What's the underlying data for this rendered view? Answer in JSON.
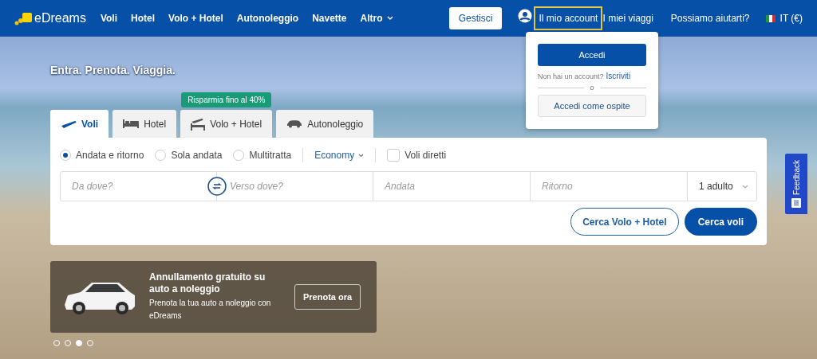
{
  "header": {
    "logo": "eDreams",
    "nav": [
      {
        "label": "Voli",
        "dropdown": false
      },
      {
        "label": "Hotel",
        "dropdown": false
      },
      {
        "label": "Volo + Hotel",
        "dropdown": false
      },
      {
        "label": "Autonoleggio",
        "dropdown": false
      },
      {
        "label": "Navette",
        "dropdown": false
      },
      {
        "label": "Altro",
        "dropdown": true
      }
    ],
    "manage_button": "Gestisci",
    "account_link": {
      "label": "Il mio account",
      "highlighted": true
    },
    "trips_link": "I miei viaggi",
    "help_link": "Possiamo aiutarti?",
    "locale": "IT (€)"
  },
  "account_menu": {
    "login_button": "Accedi",
    "signup_prompt": "Non hai un account?",
    "signup_link": "Iscriviti",
    "separator": "o",
    "guest_button": "Accedi come ospite"
  },
  "hero": {
    "tagline": "Entra. Prenota. Viaggia."
  },
  "tabs": [
    {
      "label": "Voli",
      "kind": "plane",
      "selected": true
    },
    {
      "label": "Hotel",
      "kind": "bed",
      "selected": false
    },
    {
      "label": "Volo + Hotel",
      "kind": "plane-bed",
      "selected": false,
      "badge": "Risparmia fino al 40%"
    },
    {
      "label": "Autonoleggio",
      "kind": "car",
      "selected": false
    }
  ],
  "trip_types": [
    {
      "label": "Andata e ritorno",
      "selected": true
    },
    {
      "label": "Sola andata",
      "selected": false
    },
    {
      "label": "Multitratta",
      "selected": false
    }
  ],
  "cabin_class": "Economy",
  "direct_flights": {
    "label": "Voli diretti",
    "checked": false
  },
  "fields": {
    "origin": {
      "placeholder": "Da dove?"
    },
    "destination": {
      "placeholder": "Verso dove?"
    },
    "departure": {
      "placeholder": "Andata"
    },
    "return": {
      "placeholder": "Ritorno"
    },
    "passengers": "1 adulto"
  },
  "buttons": {
    "secondary": "Cerca Volo + Hotel",
    "primary": "Cerca voli"
  },
  "promo": {
    "title": "Annullamento gratuito su auto a noleggio",
    "text": "Prenota la tua auto a noleggio con eDreams",
    "button": "Prenota ora"
  },
  "carousel_dots": [
    {
      "selected": false
    },
    {
      "selected": false
    },
    {
      "selected": true
    },
    {
      "selected": false
    }
  ],
  "feedback": "Feedback"
}
